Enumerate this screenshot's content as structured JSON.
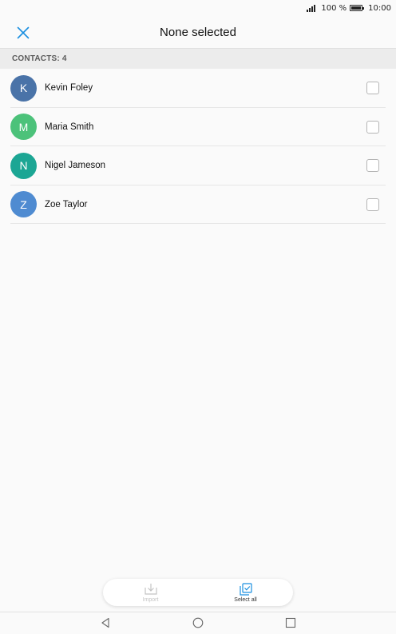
{
  "status_bar": {
    "battery": "100 %",
    "time": "10:00"
  },
  "app_bar": {
    "title": "None selected"
  },
  "section": {
    "header": "CONTACTS: 4"
  },
  "contacts": [
    {
      "initial": "K",
      "name": "Kevin Foley",
      "color": "#4a73a8"
    },
    {
      "initial": "M",
      "name": "Maria Smith",
      "color": "#4cc27a"
    },
    {
      "initial": "N",
      "name": "Nigel Jameson",
      "color": "#1ca694"
    },
    {
      "initial": "Z",
      "name": "Zoe Taylor",
      "color": "#4f8bd1"
    }
  ],
  "bottom_bar": {
    "import_label": "Import",
    "select_all_label": "Select all"
  },
  "colors": {
    "accent": "#1a8fe0",
    "disabled": "#c4c4c4"
  }
}
